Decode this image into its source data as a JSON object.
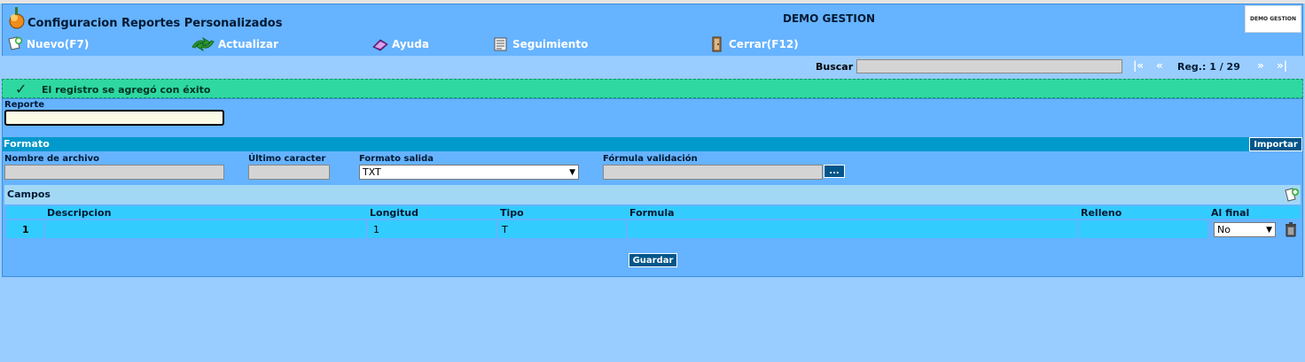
{
  "header": {
    "app_title": "Configuracion Reportes Personalizados",
    "company": "DEMO GESTION",
    "company_logo_text": "DEMO GESTION"
  },
  "toolbar": {
    "new_label": "Nuevo(F7)",
    "update_label": "Actualizar",
    "help_label": "Ayuda",
    "tracking_label": "Seguimiento",
    "close_label": "Cerrar(F12)"
  },
  "search": {
    "label": "Buscar",
    "value": "",
    "nav_first": "|«",
    "nav_prev": "«",
    "reg_label": "Reg.: 1 / 29",
    "nav_next": "»",
    "nav_last": "»|"
  },
  "message": {
    "text": "El registro se agregó con éxito",
    "check": "✓"
  },
  "form": {
    "reporte_label": "Reporte",
    "reporte_value": "",
    "formato_title": "Formato",
    "import_label": "Importar",
    "filename_label": "Nombre de archivo",
    "filename_value": "",
    "last_char_label": "Último caracter",
    "last_char_value": "",
    "output_label": "Formato salida",
    "output_value": "TXT",
    "formula_label": "Fórmula validación",
    "formula_value": "",
    "dots_label": "...",
    "campos_title": "Campos",
    "save_label": "Guardar"
  },
  "table": {
    "headers": {
      "descripcion": "Descripcion",
      "longitud": "Longitud",
      "tipo": "Tipo",
      "formula": "Formula",
      "relleno": "Relleno",
      "al_final": "Al final"
    },
    "rows": [
      {
        "num": "1",
        "descripcion": "",
        "longitud": "1",
        "tipo": "T",
        "formula": "",
        "relleno": "",
        "al_final": "No"
      }
    ]
  },
  "icons": {
    "app_logo": "app-logo-icon",
    "new": "new-document-icon",
    "update": "refresh-icon",
    "help": "help-book-icon",
    "tracking": "tracking-list-icon",
    "close": "exit-door-icon",
    "add_field": "add-field-icon",
    "delete_row": "trash-icon"
  },
  "colors": {
    "background": "#99ccff",
    "header": "#66b3ff",
    "success": "#2ed8a0",
    "section_bar": "#0099cc",
    "table_cell": "#33ccff",
    "button": "#00568a"
  }
}
